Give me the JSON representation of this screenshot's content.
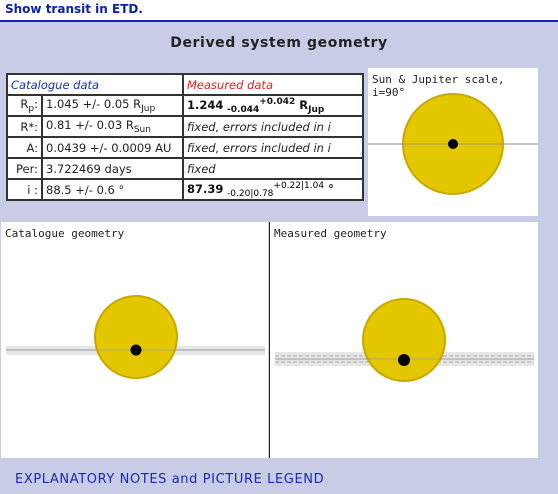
{
  "top_link": "Show transit in ETD.",
  "title": "Derived system geometry",
  "table": {
    "header_catalogue": "Catalogue data",
    "header_measured": "Measured data",
    "rows": [
      {
        "label_main": "R",
        "label_sub": "p",
        "label_tail": ":",
        "cat_main": "1.045 +/- 0.05 R",
        "cat_sub": "Jup",
        "meas_main": "1.244",
        "meas_sub": "-0.044",
        "meas_sup": "+0.042",
        "meas_tail": " R",
        "meas_tail_sub": "Jup"
      },
      {
        "label_main": "R*:",
        "cat_main": "0.81 +/- 0.03 R",
        "cat_sub": "Sun",
        "meas_text": "fixed, errors included in i"
      },
      {
        "label_main": "A:",
        "cat_main": "0.0439 +/- 0.0009 AU",
        "meas_text": "fixed, errors included in i"
      },
      {
        "label_main": "Per:",
        "cat_main": "3.722469 days",
        "meas_text": "fixed"
      },
      {
        "label_main": "i :",
        "cat_main": "88.5 +/- 0.6 °",
        "meas_main": "87.39",
        "meas_sub": "-0.20|0.78",
        "meas_sup": "+0.22|1.04",
        "meas_tail": " °"
      }
    ]
  },
  "panels": {
    "scale_label": "Sun & Jupiter scale, i=90°",
    "catalogue_label": "Catalogue geometry",
    "measured_label": "Measured geometry"
  },
  "colors": {
    "star": "#e3c800",
    "star_edge": "#c9a800",
    "planet": "#000000",
    "link": "#0b1fa8"
  },
  "footer": "EXPLANATORY NOTES and PICTURE LEGEND"
}
